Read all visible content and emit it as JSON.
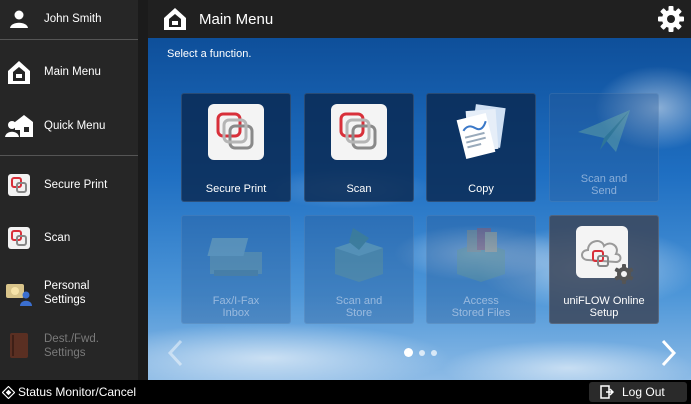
{
  "sidebar": {
    "user_name": "John Smith",
    "items": [
      {
        "label": "Main Menu",
        "icon": "home-icon"
      },
      {
        "label": "Quick Menu",
        "icon": "quick-menu-icon"
      },
      {
        "label": "Secure Print",
        "icon": "secure-print-icon"
      },
      {
        "label": "Scan",
        "icon": "scan-icon"
      },
      {
        "label": "Personal\nSettings",
        "icon": "personal-settings-icon"
      },
      {
        "label": "Dest./Fwd.\nSettings",
        "icon": "dest-fwd-settings-icon"
      }
    ]
  },
  "header": {
    "title": "Main Menu",
    "settings_icon": "gear-icon"
  },
  "main": {
    "prompt": "Select a function.",
    "tiles": [
      {
        "label": "Secure Print",
        "enabled": true
      },
      {
        "label": "Scan",
        "enabled": true
      },
      {
        "label": "Copy",
        "enabled": true
      },
      {
        "label": "Scan and\nSend",
        "enabled": false
      },
      {
        "label": "Fax/I-Fax\nInbox",
        "enabled": false
      },
      {
        "label": "Scan and\nStore",
        "enabled": false
      },
      {
        "label": "Access\nStored Files",
        "enabled": false
      },
      {
        "label": "uniFLOW Online\nSetup",
        "enabled": true
      }
    ],
    "page_indicator": {
      "pages": 3,
      "current": 1
    }
  },
  "bottom": {
    "status_label": "Status Monitor/Cancel",
    "logout_label": "Log Out"
  },
  "colors": {
    "accent_red": "#d8303a",
    "sidebar_bg": "#262626",
    "tile_bg": "#0a2850"
  }
}
